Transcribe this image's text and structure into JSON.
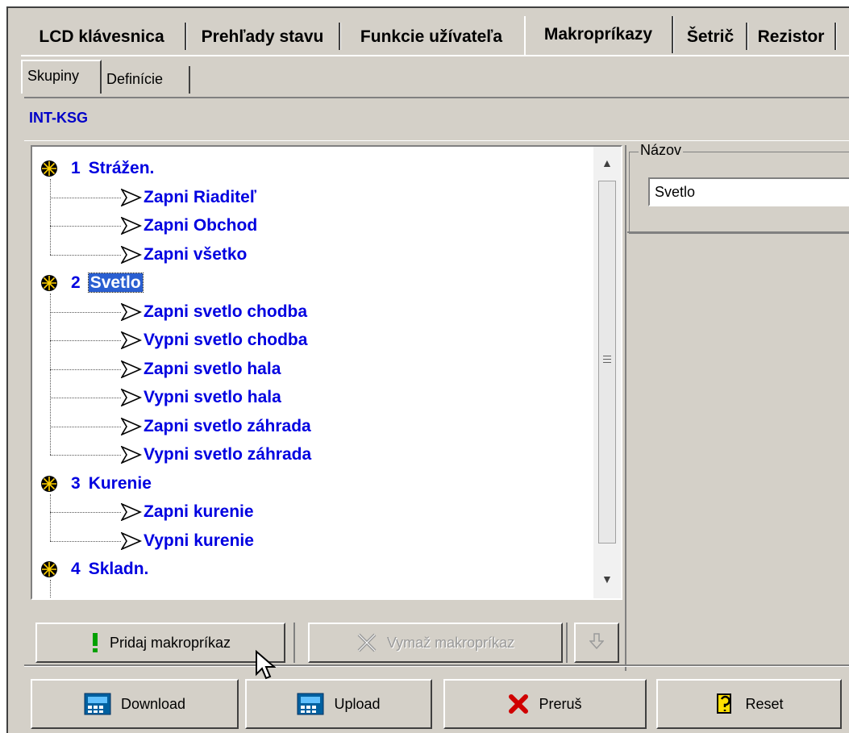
{
  "tabs": {
    "main": [
      "LCD klávesnica",
      "Prehľady stavu",
      "Funkcie užívateľa",
      "Makropríkazy",
      "Šetrič",
      "Rezistor"
    ],
    "active": "Makropríkazy",
    "sub": [
      "Skupiny",
      "Definície"
    ]
  },
  "banner": {
    "title": "INT-KSG"
  },
  "tree": {
    "groups": [
      {
        "num": "1",
        "name": "Strážen.",
        "items": [
          "Zapni Riaditeľ",
          "Zapni Obchod",
          "Zapni všetko"
        ]
      },
      {
        "num": "2",
        "name": "Svetlo",
        "items": [
          "Zapni svetlo chodba",
          "Vypni svetlo chodba",
          "Zapni svetlo hala",
          "Vypni svetlo hala",
          "Zapni svetlo záhrada",
          "Vypni svetlo záhrada"
        ]
      },
      {
        "num": "3",
        "name": "Kurenie",
        "items": [
          "Zapni kurenie",
          "Vypni kurenie"
        ]
      },
      {
        "num": "4",
        "name": "Skladn.",
        "items": []
      }
    ],
    "selected_group": "2"
  },
  "name_panel": {
    "legend": "Názov",
    "value": "Svetlo"
  },
  "buttons": {
    "add": "Pridaj makropríkaz",
    "delete": "Vymaž makropríkaz",
    "download": "Download",
    "upload": "Upload",
    "abort": "Preruš",
    "reset": "Reset"
  },
  "colors": {
    "accent": "#0000e0",
    "selection": "#2a5fd1",
    "face": "#d4d0c8"
  }
}
